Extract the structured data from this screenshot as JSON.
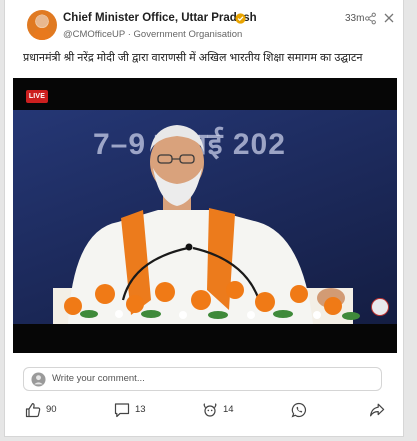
{
  "post": {
    "author": "Chief Minister Office, Uttar Pradesh",
    "handle_line": "@CMOfficeUP · Government Organisation",
    "time": "33m",
    "text": "प्रधानमंत्री श्री नरेंद्र मोदी जी द्वारा वाराणसी में अखिल भारतीय शिक्षा समागम का उद्घाटन",
    "verified_color": "#e9a400"
  },
  "video": {
    "live_label": "LIVE",
    "backdrop_text": "7–9 जुलाई 202",
    "accent": "#cc1f1f"
  },
  "comment": {
    "placeholder": "Write your comment..."
  },
  "actions": {
    "likes": "90",
    "comments": "13",
    "reactions": "14"
  }
}
